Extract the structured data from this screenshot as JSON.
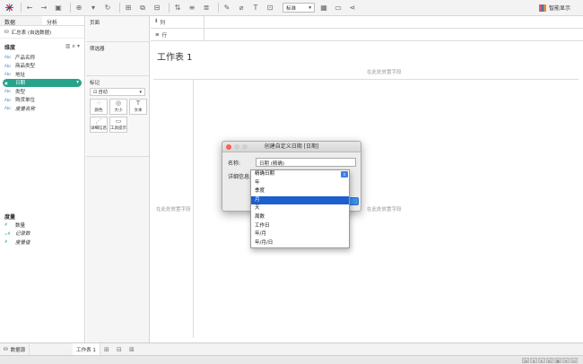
{
  "toolbar": {
    "mark_type_select": "标准",
    "show_me_label": "智能显示"
  },
  "left_panel": {
    "tabs": [
      "数据",
      "分析"
    ],
    "datasource": "汇总表 (自选数据)",
    "dimensions_header": "维度",
    "dimensions": [
      {
        "type": "Abc",
        "label": "产品名称",
        "style": "normal"
      },
      {
        "type": "Abc",
        "label": "商品类型",
        "style": "normal"
      },
      {
        "type": "Abc",
        "label": "地址",
        "style": "normal"
      },
      {
        "type": "▣",
        "label": "日期",
        "style": "selected"
      },
      {
        "type": "Abc",
        "label": "类型",
        "style": "normal"
      },
      {
        "type": "Abc",
        "label": "购货单位",
        "style": "normal"
      },
      {
        "type": "Abc",
        "label": "度量名称",
        "style": "italic"
      }
    ],
    "measures_header": "度量",
    "measures": [
      {
        "type": "#",
        "label": "数量",
        "style": "normal"
      },
      {
        "type": "=#",
        "label": "记录数",
        "style": "italic"
      },
      {
        "type": "#",
        "label": "度量值",
        "style": "italic"
      }
    ]
  },
  "shelves": {
    "pages": "页面",
    "filters": "筛选器",
    "marks": "标记",
    "marks_type": "自动",
    "mark_buttons": [
      "颜色",
      "大小",
      "文本",
      "详细信息",
      "工具提示"
    ],
    "columns": "列",
    "rows": "行"
  },
  "canvas": {
    "title": "工作表 1",
    "drop_field_top": "在此处放置字段",
    "drop_field_left": "在此处放置字段",
    "drop_field_right": "在此处放置字段"
  },
  "bottom": {
    "datasource_tab": "数据源",
    "sheet_tab": "工作表 1"
  },
  "dialog": {
    "title": "创建自定义日期 [日期]",
    "name_label": "名称:",
    "name_value": "日期 (精确)",
    "detail_label": "详细信息:",
    "selected_option": "精确日期",
    "options": [
      "精确日期",
      "年",
      "季度",
      "月",
      "天",
      "周数",
      "工作日",
      "年/月",
      "年/月/日"
    ],
    "highlighted_index": 3
  },
  "colors": {
    "accent_green": "#26a38a",
    "highlight_blue": "#1c5fcf"
  }
}
